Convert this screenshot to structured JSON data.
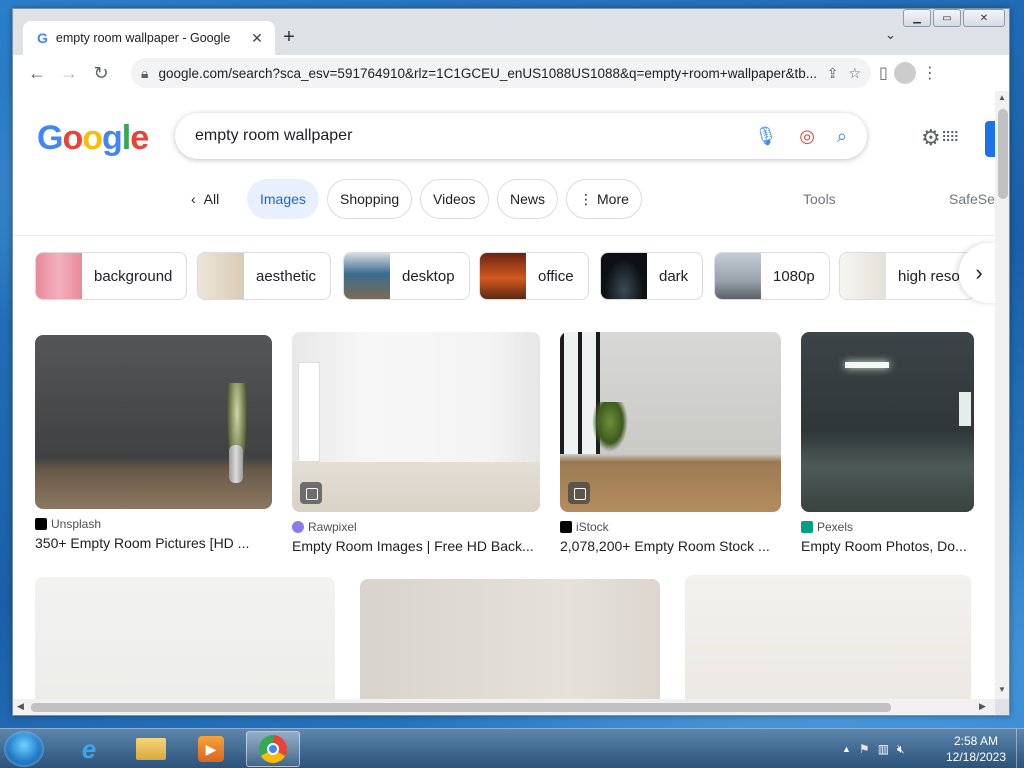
{
  "browser": {
    "tab_title": "empty room wallpaper - Google",
    "url": "google.com/search?sca_esv=591764910&rlz=1C1GCEU_enUS1088US1088&q=empty+room+wallpaper&tb..."
  },
  "search": {
    "query": "empty room wallpaper",
    "logo_letters": [
      "G",
      "o",
      "o",
      "g",
      "l",
      "e"
    ]
  },
  "filters": {
    "all": "All",
    "images": "Images",
    "shopping": "Shopping",
    "videos": "Videos",
    "news": "News",
    "more": "More",
    "tools": "Tools",
    "safesearch": "SafeSe"
  },
  "related": [
    {
      "label": "background",
      "color": "#e88a9a"
    },
    {
      "label": "aesthetic",
      "color": "#e9e2d6"
    },
    {
      "label": "desktop",
      "color": "#3b6d8f"
    },
    {
      "label": "office",
      "color": "#b24a22"
    },
    {
      "label": "dark",
      "color": "#0d1114"
    },
    {
      "label": "1080p",
      "color": "#9aa3ad"
    },
    {
      "label": "high reso",
      "color": "#f1f0ec"
    }
  ],
  "results": [
    {
      "source": "Unsplash",
      "title": "350+ Empty Room Pictures [HD ...",
      "fav_color": "#000000"
    },
    {
      "source": "Rawpixel",
      "title": "Empty Room Images | Free HD Back...",
      "fav_color": "#8a7de8"
    },
    {
      "source": "iStock",
      "title": "2,078,200+ Empty Room Stock ...",
      "fav_color": "#000000"
    },
    {
      "source": "Pexels",
      "title": "Empty Room Photos, Do...",
      "fav_color": "#05a081"
    }
  ],
  "taskbar": {
    "time": "2:58 AM",
    "date": "12/18/2023"
  }
}
